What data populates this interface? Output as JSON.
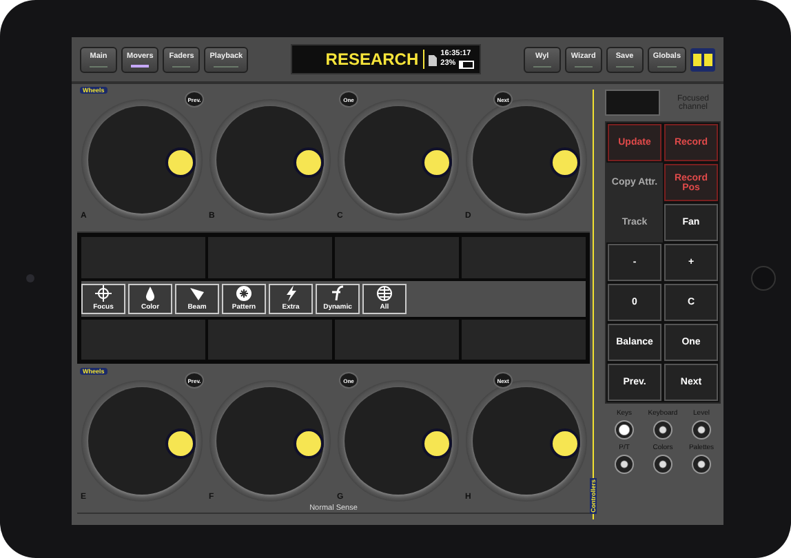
{
  "top_bar": {
    "left_tabs": [
      {
        "label": "Main",
        "selected": false
      },
      {
        "label": "Movers",
        "selected": true
      },
      {
        "label": "Faders",
        "selected": false
      },
      {
        "label": "Playback",
        "selected": false
      }
    ],
    "display": {
      "title": "RESEARCH",
      "time": "16:35:17",
      "battery": "23%"
    },
    "right_tabs": [
      {
        "label": "Wyl",
        "selected": false
      },
      {
        "label": "Wizard",
        "selected": false
      },
      {
        "label": "Save",
        "selected": false
      },
      {
        "label": "Globals",
        "selected": false
      }
    ]
  },
  "wheel_banks": [
    {
      "title": "Wheels",
      "nav": [
        "Prev.",
        "One",
        "Next"
      ],
      "wheels": [
        "A",
        "B",
        "C",
        "D"
      ]
    },
    {
      "title": "Wheels",
      "nav": [
        "Prev.",
        "One",
        "Next"
      ],
      "wheels": [
        "E",
        "F",
        "G",
        "H"
      ],
      "footer": "Normal Sense"
    }
  ],
  "attributes": [
    "Focus",
    "Color",
    "Beam",
    "Pattern",
    "Extra",
    "Dynamic",
    "All"
  ],
  "side_label": "Controllers",
  "focused_channel": {
    "label": "Focused channel"
  },
  "keypad": [
    {
      "label": "Update",
      "kind": "record"
    },
    {
      "label": "Record",
      "kind": "record"
    },
    {
      "label": "Copy Attr.",
      "kind": "text"
    },
    {
      "label": "Record Pos",
      "kind": "record"
    },
    {
      "label": "Track",
      "kind": "text"
    },
    {
      "label": "Fan",
      "kind": "key"
    },
    {
      "label": "-",
      "kind": "key"
    },
    {
      "label": "+",
      "kind": "key"
    },
    {
      "label": "0",
      "kind": "key"
    },
    {
      "label": "C",
      "kind": "key"
    },
    {
      "label": "Balance",
      "kind": "key"
    },
    {
      "label": "One",
      "kind": "key"
    },
    {
      "label": "Prev.",
      "kind": "key"
    },
    {
      "label": "Next",
      "kind": "key"
    }
  ],
  "indicators": [
    {
      "label": "Keys",
      "on": true
    },
    {
      "label": "Keyboard",
      "on": false
    },
    {
      "label": "Level",
      "on": false
    },
    {
      "label": "P/T",
      "on": false
    },
    {
      "label": "Colors",
      "on": false
    },
    {
      "label": "Palettes",
      "on": false
    }
  ]
}
